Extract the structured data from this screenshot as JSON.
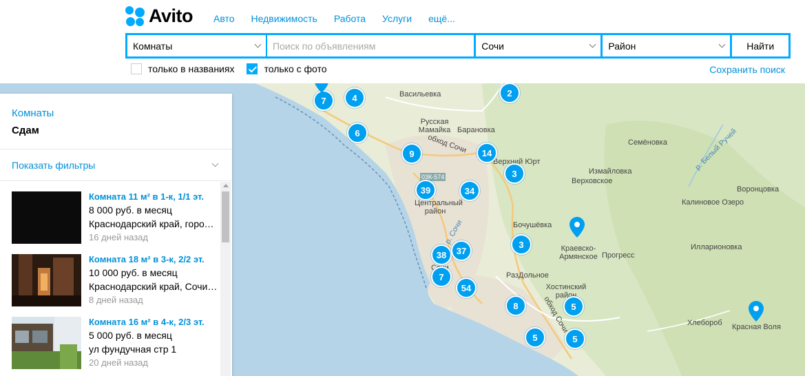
{
  "logo": {
    "text": "Avito"
  },
  "nav": [
    "Авто",
    "Недвижимость",
    "Работа",
    "Услуги",
    "ещё..."
  ],
  "search": {
    "category": "Комнаты",
    "query_placeholder": "Поиск по объявлениям",
    "city": "Сочи",
    "region": "Район",
    "button": "Найти"
  },
  "filters": {
    "titles_only": {
      "label": "только в названиях",
      "checked": false
    },
    "with_photo": {
      "label": "только с фото",
      "checked": true
    },
    "save_search": "Сохранить поиск"
  },
  "sidebar": {
    "category": "Комнаты",
    "subtitle": "Сдам",
    "show_filters": "Показать фильтры",
    "listings": [
      {
        "title": "Комната 11 м² в 1-к, 1/1 эт.",
        "price": "8 000 руб. в месяц",
        "address": "Краснодарский край, город Сочи",
        "date": "16 дней назад"
      },
      {
        "title": "Комната 18 м² в 3-к, 2/2 эт.",
        "price": "10 000 руб. в месяц",
        "address": "Краснодарский край, Сочи, ул",
        "date": "8 дней назад"
      },
      {
        "title": "Комната 16 м² в 4-к, 2/3 эт.",
        "price": "5 000 руб. в месяц",
        "address": "ул фундучная стр 1",
        "date": "20 дней назад"
      }
    ]
  },
  "map": {
    "places": [
      "Васильевка",
      "Русская Мамайка",
      "Барановка",
      "обход Сочи",
      "Верхний Юрт",
      "Центральный район",
      "03К-574",
      "Семёновка",
      "Измайловка",
      "Верховское",
      "р. Белый Ручей",
      "Воронцовка",
      "Калиновое Озеро",
      "Бочушёвка",
      "Краевско-Армянское",
      "Прогресс",
      "Илларионовка",
      "РазДольное",
      "Хостинский район",
      "обход Сочи",
      "Хлеборoб",
      "Красная Воля",
      "Сочи",
      "р. Сочи"
    ],
    "clusters": [
      "7",
      "4",
      "2",
      "6",
      "9",
      "14",
      "3",
      "39",
      "34",
      "3",
      "38",
      "37",
      "7",
      "54",
      "8",
      "5",
      "5",
      "5"
    ]
  },
  "colors": {
    "accent": "#00aaff",
    "link": "#0091d9",
    "cluster": "#00a0f0",
    "water": "#b5d4e8",
    "land": "#e9ecd6"
  }
}
